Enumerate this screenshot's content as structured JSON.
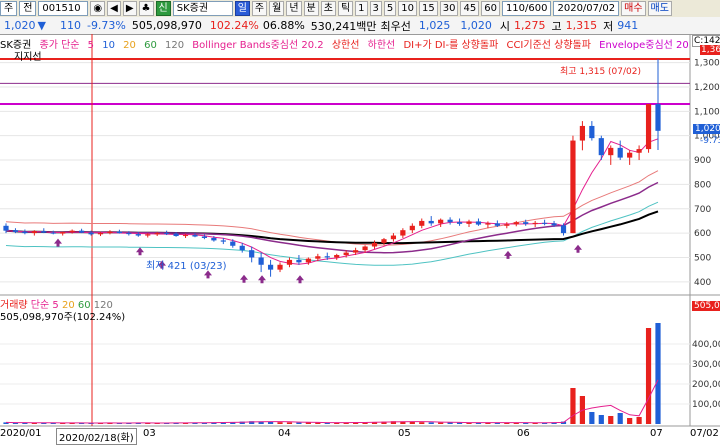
{
  "toolbar1": {
    "items": [
      "주",
      "전",
      "001510",
      "◉",
      "◀",
      "▶",
      "♣",
      "신",
      "SK증권",
      "일",
      "주",
      "월",
      "년",
      "분",
      "초",
      "틱",
      "1",
      "3",
      "5",
      "10",
      "15",
      "30",
      "45",
      "60",
      "110/600",
      "2020/07/02",
      "매수",
      "매도"
    ]
  },
  "toolbar2": {
    "price": "1,020",
    "arrow": "▼",
    "change": "110",
    "rate": "-9.73%",
    "volume": "505,098,970",
    "vol_ratio": "102.24%",
    "turnover": "06.88%",
    "amount": "530,241백만",
    "status": "최우선",
    "bid": "1,025",
    "ask": "1,020",
    "open_label": "시",
    "open": "1,275",
    "high_label": "고",
    "high": "1,315",
    "low_label": "저",
    "low": "941"
  },
  "indicators": {
    "stock": "SK증권",
    "ma_label": "종가 단순",
    "ma_periods": [
      "5",
      "10",
      "20",
      "60",
      "120"
    ],
    "items": [
      "Bollinger Bands중심선 20.2",
      "상한선",
      "하한선",
      "DI+가 DI-를 상향돌파",
      "CCI기준선 상향돌파",
      "Envelope중심선 20."
    ],
    "sub_label": "지지선"
  },
  "annotations": {
    "high": "최고 1,315 (07/02)",
    "low": "최저 421 (03/23)",
    "price_tag": "1,020",
    "change_tag": "-9.73%",
    "top_tag": "C:142",
    "top_tag2": "1,36"
  },
  "price_axis": [
    "1,300",
    "1,200",
    "1,100",
    "1,000",
    "900",
    "800",
    "700",
    "600",
    "500",
    "400"
  ],
  "volume_panel": {
    "label": "거래량",
    "ma_label": "단순",
    "periods": [
      "5",
      "20",
      "60",
      "120"
    ],
    "current": "505,098,970주(102.24%)",
    "axis": [
      "505,09",
      "400,00",
      "300,00",
      "200,00",
      "100,00"
    ]
  },
  "x_axis": {
    "labels": [
      "2020/01",
      "2020/02/18(화)",
      "03",
      "04",
      "05",
      "06",
      "07"
    ],
    "end": "07/02"
  },
  "colors": {
    "up": "#e8211d",
    "down": "#1f5fd6",
    "ma5": "#e51f8e",
    "ma20": "#e87a7a",
    "ma60": "#000000",
    "bb_lower": "#4fc3c3",
    "guide": "#cc00cc",
    "cursor": "#e8211d"
  },
  "chart_data": {
    "type": "candlestick",
    "ylim": [
      350,
      1360
    ],
    "candles": [
      [
        630,
        640,
        600,
        610
      ],
      [
        612,
        620,
        600,
        605
      ],
      [
        606,
        615,
        595,
        600
      ],
      [
        600,
        612,
        590,
        608
      ],
      [
        608,
        620,
        600,
        602
      ],
      [
        602,
        610,
        595,
        598
      ],
      [
        598,
        606,
        590,
        604
      ],
      [
        604,
        615,
        598,
        610
      ],
      [
        610,
        618,
        600,
        602
      ],
      [
        602,
        610,
        590,
        595
      ],
      [
        595,
        605,
        588,
        600
      ],
      [
        600,
        612,
        595,
        606
      ],
      [
        606,
        614,
        598,
        600
      ],
      [
        600,
        608,
        590,
        596
      ],
      [
        596,
        604,
        585,
        590
      ],
      [
        590,
        600,
        582,
        595
      ],
      [
        595,
        605,
        588,
        600
      ],
      [
        600,
        610,
        592,
        598
      ],
      [
        598,
        604,
        585,
        588
      ],
      [
        588,
        598,
        580,
        592
      ],
      [
        592,
        600,
        583,
        586
      ],
      [
        586,
        594,
        575,
        580
      ],
      [
        580,
        588,
        565,
        570
      ],
      [
        570,
        580,
        555,
        565
      ],
      [
        565,
        575,
        540,
        548
      ],
      [
        548,
        560,
        520,
        530
      ],
      [
        530,
        545,
        480,
        500
      ],
      [
        500,
        520,
        440,
        470
      ],
      [
        470,
        490,
        421,
        450
      ],
      [
        450,
        480,
        440,
        470
      ],
      [
        470,
        500,
        460,
        490
      ],
      [
        490,
        510,
        470,
        480
      ],
      [
        480,
        500,
        470,
        495
      ],
      [
        495,
        515,
        485,
        505
      ],
      [
        505,
        520,
        490,
        500
      ],
      [
        500,
        515,
        490,
        510
      ],
      [
        510,
        530,
        500,
        520
      ],
      [
        520,
        540,
        510,
        530
      ],
      [
        530,
        550,
        520,
        545
      ],
      [
        545,
        570,
        535,
        560
      ],
      [
        560,
        580,
        550,
        575
      ],
      [
        575,
        600,
        565,
        590
      ],
      [
        590,
        620,
        580,
        612
      ],
      [
        612,
        640,
        600,
        630
      ],
      [
        630,
        660,
        620,
        650
      ],
      [
        650,
        670,
        630,
        640
      ],
      [
        640,
        660,
        625,
        655
      ],
      [
        655,
        665,
        635,
        645
      ],
      [
        645,
        660,
        630,
        638
      ],
      [
        638,
        655,
        625,
        648
      ],
      [
        648,
        660,
        630,
        635
      ],
      [
        635,
        648,
        620,
        640
      ],
      [
        640,
        652,
        625,
        630
      ],
      [
        630,
        645,
        620,
        636
      ],
      [
        636,
        650,
        628,
        645
      ],
      [
        645,
        655,
        630,
        638
      ],
      [
        638,
        650,
        625,
        642
      ],
      [
        642,
        655,
        632,
        640
      ],
      [
        640,
        650,
        625,
        632
      ],
      [
        632,
        640,
        590,
        600
      ],
      [
        600,
        1000,
        600,
        980
      ],
      [
        980,
        1060,
        940,
        1040
      ],
      [
        1040,
        1060,
        980,
        990
      ],
      [
        990,
        1000,
        900,
        920
      ],
      [
        920,
        960,
        880,
        950
      ],
      [
        950,
        980,
        900,
        910
      ],
      [
        910,
        940,
        880,
        930
      ],
      [
        930,
        960,
        900,
        945
      ],
      [
        945,
        1100,
        930,
        1130
      ],
      [
        1130,
        1315,
        941,
        1020
      ]
    ],
    "volumes": [
      8,
      6,
      7,
      5,
      6,
      5,
      5,
      6,
      5,
      5,
      5,
      6,
      5,
      5,
      6,
      5,
      5,
      5,
      6,
      7,
      6,
      7,
      8,
      9,
      10,
      12,
      14,
      13,
      11,
      9,
      8,
      7,
      8,
      7,
      6,
      7,
      8,
      9,
      8,
      10,
      12,
      14,
      13,
      11,
      9,
      8,
      7,
      8,
      7,
      6,
      7,
      8,
      7,
      6,
      7,
      6,
      7,
      6,
      8,
      12,
      180,
      140,
      60,
      45,
      40,
      55,
      30,
      35,
      480,
      505
    ]
  }
}
